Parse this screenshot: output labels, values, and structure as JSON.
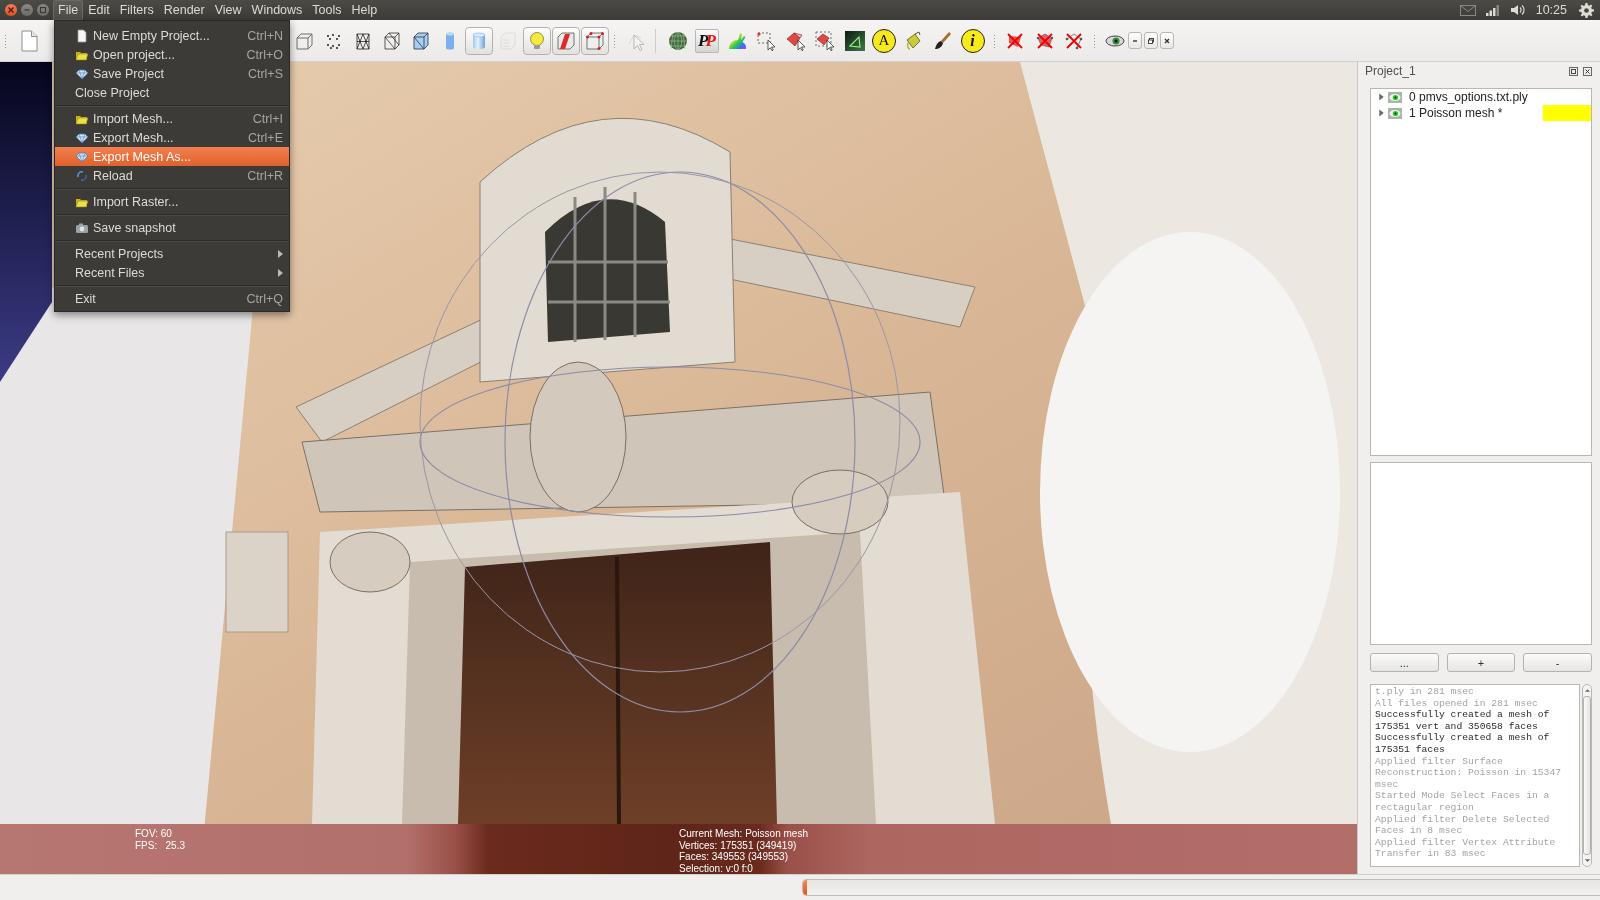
{
  "top_bar": {
    "menus": [
      {
        "label": "File",
        "selected": true
      },
      {
        "label": "Edit",
        "selected": false
      },
      {
        "label": "Filters",
        "selected": false
      },
      {
        "label": "Render",
        "selected": false
      },
      {
        "label": "View",
        "selected": false
      },
      {
        "label": "Windows",
        "selected": false
      },
      {
        "label": "Tools",
        "selected": false
      },
      {
        "label": "Help",
        "selected": false
      }
    ],
    "clock": "10:25"
  },
  "toolbar": {
    "groups": [
      {
        "buttons": [
          {
            "kind": "icon",
            "pressed": false,
            "disabled": false
          }
        ]
      },
      {
        "buttons": [
          {
            "kind": "icon",
            "pressed": false,
            "disabled": false
          },
          {
            "kind": "icon",
            "pressed": false,
            "disabled": false
          },
          {
            "kind": "icon",
            "pressed": false,
            "disabled": false
          },
          {
            "kind": "icon",
            "pressed": false,
            "disabled": false
          },
          {
            "kind": "icon",
            "pressed": false,
            "disabled": false
          },
          {
            "kind": "icon",
            "pressed": false,
            "disabled": false
          },
          {
            "kind": "icon",
            "pressed": true,
            "disabled": false
          },
          {
            "kind": "icon",
            "pressed": false,
            "disabled": true
          },
          {
            "kind": "icon",
            "pressed": true,
            "disabled": false
          },
          {
            "kind": "icon",
            "pressed": true,
            "disabled": false
          },
          {
            "kind": "icon",
            "pressed": true,
            "disabled": false
          }
        ]
      },
      {
        "buttons": [
          {
            "kind": "icon",
            "pressed": false,
            "disabled": true
          }
        ]
      },
      {
        "buttons": [
          {
            "kind": "icon",
            "pressed": false,
            "disabled": false
          },
          {
            "kind": "glyph",
            "text": "PP",
            "pressed": false,
            "disabled": false
          },
          {
            "kind": "icon",
            "pressed": false,
            "disabled": false
          },
          {
            "kind": "icon",
            "pressed": false,
            "disabled": false
          },
          {
            "kind": "icon",
            "pressed": false,
            "disabled": false
          },
          {
            "kind": "icon",
            "pressed": false,
            "disabled": false
          },
          {
            "kind": "icon",
            "pressed": false,
            "disabled": false
          },
          {
            "kind": "glyph",
            "text": "A",
            "pressed": false,
            "disabled": false
          },
          {
            "kind": "icon",
            "pressed": false,
            "disabled": false
          },
          {
            "kind": "icon",
            "pressed": false,
            "disabled": false
          },
          {
            "kind": "glyph",
            "text": "i",
            "pressed": false,
            "disabled": false
          }
        ]
      },
      {
        "buttons": [
          {
            "kind": "icon",
            "pressed": false,
            "disabled": false
          },
          {
            "kind": "icon",
            "pressed": false,
            "disabled": false
          },
          {
            "kind": "icon",
            "pressed": false,
            "disabled": false
          }
        ]
      },
      {
        "buttons": [
          {
            "kind": "icon",
            "pressed": false,
            "disabled": false
          }
        ]
      }
    ]
  },
  "file_menu": {
    "groups": [
      {
        "items": [
          {
            "kind": "command",
            "label": "New Empty Project...",
            "shortcut": "Ctrl+N",
            "selected": false
          },
          {
            "kind": "command",
            "label": "Open project...",
            "shortcut": "Ctrl+O",
            "selected": false
          },
          {
            "kind": "command",
            "label": "Save Project",
            "shortcut": "Ctrl+S",
            "selected": false
          },
          {
            "kind": "command",
            "label": "Close Project",
            "selected": false
          }
        ]
      },
      {
        "items": [
          {
            "kind": "command",
            "label": "Import Mesh...",
            "shortcut": "Ctrl+I",
            "selected": false
          },
          {
            "kind": "command",
            "label": "Export Mesh...",
            "shortcut": "Ctrl+E",
            "selected": false
          },
          {
            "kind": "command",
            "label": "Export Mesh As...",
            "selected": true
          },
          {
            "kind": "command",
            "label": "Reload",
            "shortcut": "Ctrl+R",
            "selected": false
          }
        ]
      },
      {
        "items": [
          {
            "kind": "command",
            "label": "Import Raster...",
            "selected": false
          }
        ]
      },
      {
        "items": [
          {
            "kind": "command",
            "label": "Save snapshot",
            "selected": false
          }
        ]
      },
      {
        "items": [
          {
            "kind": "submenu",
            "label": "Recent Projects",
            "selected": false
          },
          {
            "kind": "submenu",
            "label": "Recent Files",
            "selected": false
          }
        ]
      },
      {
        "items": [
          {
            "kind": "command",
            "label": "Exit",
            "shortcut": "Ctrl+Q",
            "selected": false
          }
        ]
      }
    ]
  },
  "viewport": {
    "render_stats": [
      "FOV: 60",
      "FPS:   25.3"
    ],
    "mesh_info": [
      "Current Mesh: Poisson mesh",
      "Vertices: 175351 (349419)",
      "Faces: 349553 (349553)",
      "Selection: v:0 f:0"
    ]
  },
  "layer_panel": {
    "title": "Project_1",
    "layers": [
      {
        "index": "0",
        "name": "pmvs_options.txt.ply",
        "expanded": false,
        "visible": true,
        "selected": false
      },
      {
        "index": "1",
        "name": "Poisson mesh *",
        "expanded": false,
        "visible": true,
        "selected": true
      }
    ]
  },
  "panel_buttons": [
    "...",
    "+",
    "-"
  ],
  "log": [
    {
      "kind": "info",
      "text": "t.ply in 281 msec"
    },
    {
      "kind": "info",
      "text": "All files opened in 281 msec"
    },
    {
      "kind": "result",
      "text": "Successfully created a mesh of 175351 vert and 350658 faces"
    },
    {
      "kind": "result",
      "text": "Successfully created a mesh of 175351 faces"
    },
    {
      "kind": "info",
      "text": "Applied filter Surface Reconstruction: Poisson in 15347 msec"
    },
    {
      "kind": "info",
      "text": "Started Mode Select Faces in a rectagular region"
    },
    {
      "kind": "info",
      "text": "Applied filter Delete Selected Faces in 8 msec"
    },
    {
      "kind": "info",
      "text": "Applied filter Vertex Attribute Transfer in 83 msec"
    }
  ],
  "status_bar": {
    "progress": {
      "level": 0.005
    }
  }
}
